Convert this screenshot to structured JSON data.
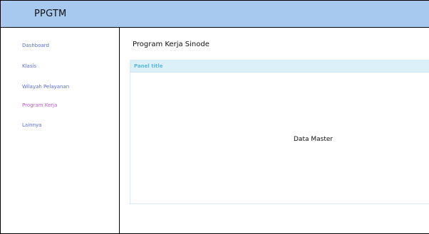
{
  "app": {
    "title": "PPGTM"
  },
  "sidebar": {
    "items": [
      {
        "label": "Dashboard",
        "color": "#5a6fd6"
      },
      {
        "label": "Klasis",
        "color": "#5a6fd6"
      },
      {
        "label": "Wilayah Pelayanan",
        "color": "#5a6fd6"
      },
      {
        "label": "Program Kerja",
        "color": "#c05ad6",
        "active": true
      },
      {
        "label": "Lainnya",
        "color": "#5a6fd6"
      }
    ]
  },
  "main": {
    "title": "Program Kerja Sinode",
    "panel": {
      "title": "Panel title",
      "body": "Data Master"
    }
  },
  "colors": {
    "header_bg": "#a7c8ef",
    "nav_link": "#5a6fd6",
    "nav_active": "#c05ad6",
    "panel_head_bg": "#dcf0f9",
    "panel_title": "#5bb8dc"
  }
}
